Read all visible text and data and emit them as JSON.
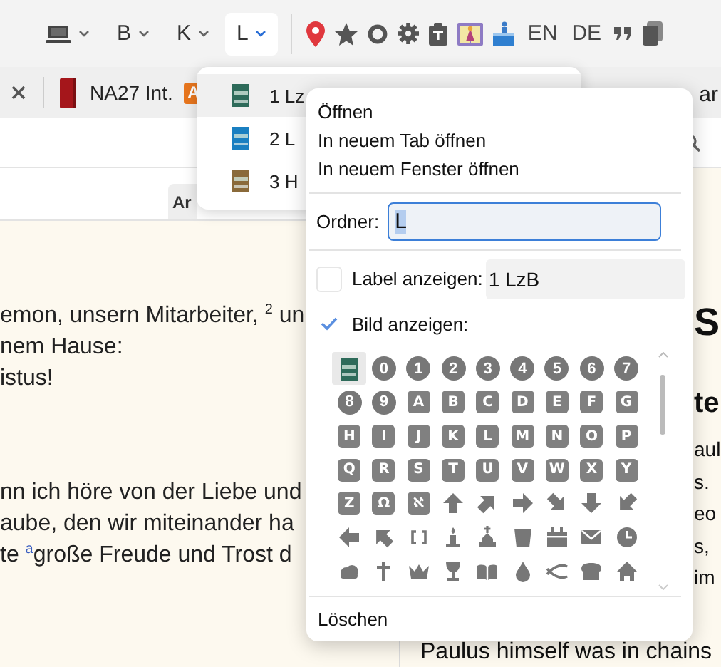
{
  "toolbar": {
    "folders": [
      {
        "kind": "device",
        "selected": false
      },
      {
        "kind": "letter",
        "label": "B",
        "selected": false
      },
      {
        "kind": "letter",
        "label": "K",
        "selected": false
      },
      {
        "kind": "letter",
        "label": "L",
        "selected": true
      }
    ],
    "languages": [
      "EN",
      "DE"
    ]
  },
  "tab_bar": {
    "tab": {
      "title": "NA27 Int.",
      "badge": "A"
    },
    "other_tab": "ar"
  },
  "pane_header": {
    "button": "Ar"
  },
  "reader": {
    "paragraphs": [
      [
        "emon, unsern Mitarbeiter, $^{2}$ un",
        "nem Hause:",
        "istus!"
      ],
      [
        "nn ich höre von der Liebe und",
        "aube, den wir miteinander ha",
        "te $^{a}$große Freude und Trost d"
      ]
    ],
    "right": {
      "heading": "S",
      "subheading": "te",
      "lines": [
        "aul",
        "s.",
        "eo",
        "s,",
        "im"
      ],
      "last_line": "Paulus himself was in chains"
    }
  },
  "folder_dropdown": {
    "items": [
      {
        "label": "1 Lz",
        "color": "#2e6b5a",
        "selected": true
      },
      {
        "label": "2 L",
        "color": "#1a7fc1",
        "selected": false
      },
      {
        "label": "3 H",
        "color": "#8a6a3a",
        "selected": false
      }
    ]
  },
  "context_menu": {
    "actions": [
      "Öffnen",
      "In neuem Tab öffnen",
      "In neuem Fenster öffnen"
    ],
    "folder": {
      "label": "Ordner:",
      "value": "L",
      "value_selected": true
    },
    "label_option": {
      "label": "Label anzeigen:",
      "checked": false,
      "value": "1 LzB"
    },
    "image_option": {
      "label": "Bild anzeigen:",
      "checked": true
    },
    "images": [
      {
        "kind": "cover",
        "selected": true
      },
      {
        "kind": "circle",
        "label": "0",
        "selected": false
      },
      {
        "kind": "circle",
        "label": "1",
        "selected": false
      },
      {
        "kind": "circle",
        "label": "2",
        "selected": false
      },
      {
        "kind": "circle",
        "label": "3",
        "selected": false
      },
      {
        "kind": "circle",
        "label": "4",
        "selected": false
      },
      {
        "kind": "circle",
        "label": "5",
        "selected": false
      },
      {
        "kind": "circle",
        "label": "6",
        "selected": false
      },
      {
        "kind": "circle",
        "label": "7",
        "selected": false
      },
      {
        "kind": "circle",
        "label": "8",
        "selected": false
      },
      {
        "kind": "circle",
        "label": "9",
        "selected": false
      },
      {
        "kind": "square",
        "label": "A",
        "selected": false
      },
      {
        "kind": "square",
        "label": "B",
        "selected": false
      },
      {
        "kind": "square",
        "label": "C",
        "selected": false
      },
      {
        "kind": "square",
        "label": "D",
        "selected": false
      },
      {
        "kind": "square",
        "label": "E",
        "selected": false
      },
      {
        "kind": "square",
        "label": "F",
        "selected": false
      },
      {
        "kind": "square",
        "label": "G",
        "selected": false
      },
      {
        "kind": "square",
        "label": "H",
        "selected": false
      },
      {
        "kind": "square",
        "label": "I",
        "selected": false
      },
      {
        "kind": "square",
        "label": "J",
        "selected": false
      },
      {
        "kind": "square",
        "label": "K",
        "selected": false
      },
      {
        "kind": "square",
        "label": "L",
        "selected": false
      },
      {
        "kind": "square",
        "label": "M",
        "selected": false
      },
      {
        "kind": "square",
        "label": "N",
        "selected": false
      },
      {
        "kind": "square",
        "label": "O",
        "selected": false
      },
      {
        "kind": "square",
        "label": "P",
        "selected": false
      },
      {
        "kind": "square",
        "label": "Q",
        "selected": false
      },
      {
        "kind": "square",
        "label": "R",
        "selected": false
      },
      {
        "kind": "square",
        "label": "S",
        "selected": false
      },
      {
        "kind": "square",
        "label": "T",
        "selected": false
      },
      {
        "kind": "square",
        "label": "U",
        "selected": false
      },
      {
        "kind": "square",
        "label": "V",
        "selected": false
      },
      {
        "kind": "square",
        "label": "W",
        "selected": false
      },
      {
        "kind": "square",
        "label": "X",
        "selected": false
      },
      {
        "kind": "square",
        "label": "Y",
        "selected": false
      },
      {
        "kind": "square",
        "label": "Z",
        "selected": false
      },
      {
        "kind": "square",
        "label": "Ω",
        "selected": false
      },
      {
        "kind": "square",
        "label": "ℵ",
        "selected": false
      },
      {
        "kind": "icon",
        "selected": false
      },
      {
        "kind": "icon",
        "selected": false
      },
      {
        "kind": "icon",
        "selected": false
      },
      {
        "kind": "icon",
        "selected": false
      },
      {
        "kind": "icon",
        "selected": false
      },
      {
        "kind": "icon",
        "selected": false
      },
      {
        "kind": "icon",
        "selected": false
      },
      {
        "kind": "icon",
        "selected": false
      },
      {
        "kind": "icon",
        "selected": false
      },
      {
        "kind": "icon",
        "selected": false
      },
      {
        "kind": "icon",
        "selected": false
      },
      {
        "kind": "icon",
        "selected": false
      },
      {
        "kind": "icon",
        "selected": false
      },
      {
        "kind": "icon",
        "selected": false
      },
      {
        "kind": "icon",
        "selected": false
      },
      {
        "kind": "icon",
        "selected": false
      },
      {
        "kind": "icon",
        "selected": false
      },
      {
        "kind": "icon",
        "selected": false
      },
      {
        "kind": "icon",
        "selected": false
      },
      {
        "kind": "icon",
        "selected": false
      },
      {
        "kind": "icon",
        "selected": false
      },
      {
        "kind": "icon",
        "selected": false
      },
      {
        "kind": "icon",
        "selected": false
      },
      {
        "kind": "icon",
        "selected": false
      }
    ],
    "delete": "Löschen"
  }
}
